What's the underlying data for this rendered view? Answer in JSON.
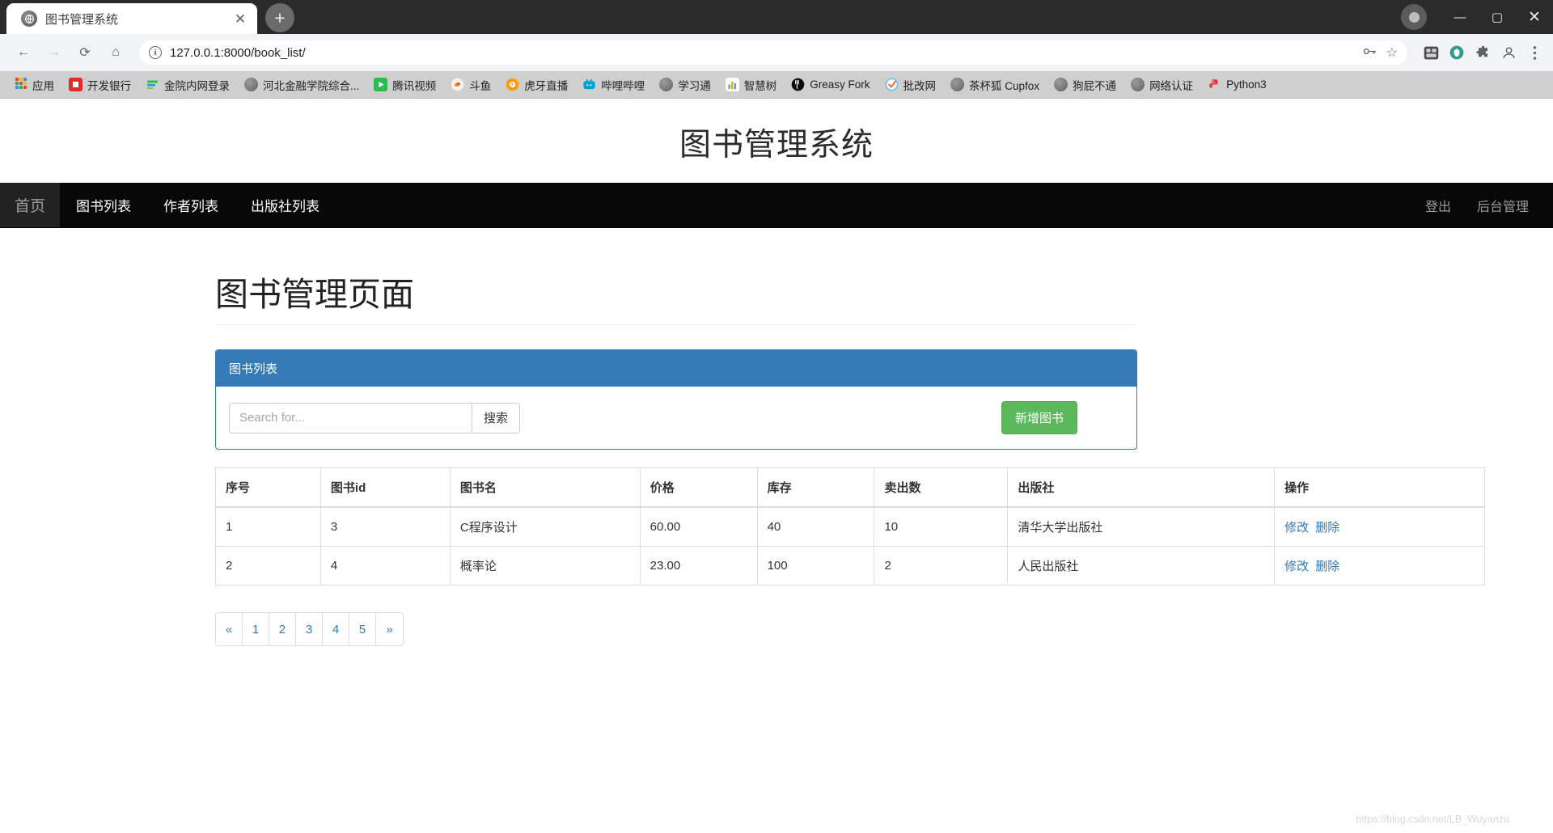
{
  "browser": {
    "tab": {
      "title": "图书管理系统",
      "favicon": "globe-icon",
      "close_label": "✕"
    },
    "new_tab_label": "+",
    "window_controls": {
      "minimize": "—",
      "maximize": "▢",
      "close": "✕"
    },
    "toolbar": {
      "back": "←",
      "forward": "→",
      "reload": "⟳",
      "home": "⌂",
      "url_host": "127.0.0.1:8000",
      "url_path": "/book_list/",
      "url_full": "127.0.0.1:8000/book_list/",
      "info_icon_label": "i",
      "key_icon": "key-icon",
      "star_icon": "☆",
      "extensions": [
        "extension-icon",
        "shield-icon",
        "puzzle-icon",
        "profile-icon",
        "menu-icon"
      ]
    },
    "bookmarks": [
      {
        "label": "应用",
        "icon": "apps-grid-icon"
      },
      {
        "label": "开发银行",
        "icon": "bank-icon"
      },
      {
        "label": "金院内网登录",
        "icon": "stripes-icon"
      },
      {
        "label": "河北金融学院综合...",
        "icon": "globe-icon"
      },
      {
        "label": "腾讯视频",
        "icon": "play-icon"
      },
      {
        "label": "斗鱼",
        "icon": "fish-icon"
      },
      {
        "label": "虎牙直播",
        "icon": "huya-icon"
      },
      {
        "label": "哔哩哔哩",
        "icon": "bilibili-icon"
      },
      {
        "label": "学习通",
        "icon": "globe-icon"
      },
      {
        "label": "智慧树",
        "icon": "chart-icon"
      },
      {
        "label": "Greasy Fork",
        "icon": "fork-icon"
      },
      {
        "label": "批改网",
        "icon": "check-icon"
      },
      {
        "label": "茶杯狐 Cupfox",
        "icon": "globe-icon"
      },
      {
        "label": "狗屁不通",
        "icon": "globe-icon"
      },
      {
        "label": "网络认证",
        "icon": "globe-icon"
      },
      {
        "label": "Python3",
        "icon": "python-icon"
      }
    ]
  },
  "site": {
    "header_title": "图书管理系统",
    "nav_left": [
      {
        "label": "首页",
        "active": true
      },
      {
        "label": "图书列表",
        "active": false
      },
      {
        "label": "作者列表",
        "active": false
      },
      {
        "label": "出版社列表",
        "active": false
      }
    ],
    "nav_right": [
      {
        "label": "登出"
      },
      {
        "label": "后台管理"
      }
    ]
  },
  "main": {
    "page_heading": "图书管理页面",
    "panel": {
      "heading": "图书列表",
      "search": {
        "placeholder": "Search for...",
        "value": "",
        "button_label": "搜索"
      },
      "add_button_label": "新增图书"
    },
    "table": {
      "columns": [
        "序号",
        "图书id",
        "图书名",
        "价格",
        "库存",
        "卖出数",
        "出版社",
        "操作"
      ],
      "rows": [
        {
          "index": "1",
          "book_id": "3",
          "name": "C程序设计",
          "price": "60.00",
          "stock": "40",
          "sold": "10",
          "publisher": "清华大学出版社",
          "edit": "修改",
          "delete": "删除"
        },
        {
          "index": "2",
          "book_id": "4",
          "name": "概率论",
          "price": "23.00",
          "stock": "100",
          "sold": "2",
          "publisher": "人民出版社",
          "edit": "修改",
          "delete": "删除"
        }
      ]
    },
    "pagination": [
      "«",
      "1",
      "2",
      "3",
      "4",
      "5",
      "»"
    ]
  },
  "watermark": "https://blog.csdn.net/LB_Wuyanzu",
  "colors": {
    "panel_blue": "#337ab7",
    "success_green": "#5cb85c",
    "navbar_black": "#080808",
    "link_blue": "#337ab7"
  }
}
